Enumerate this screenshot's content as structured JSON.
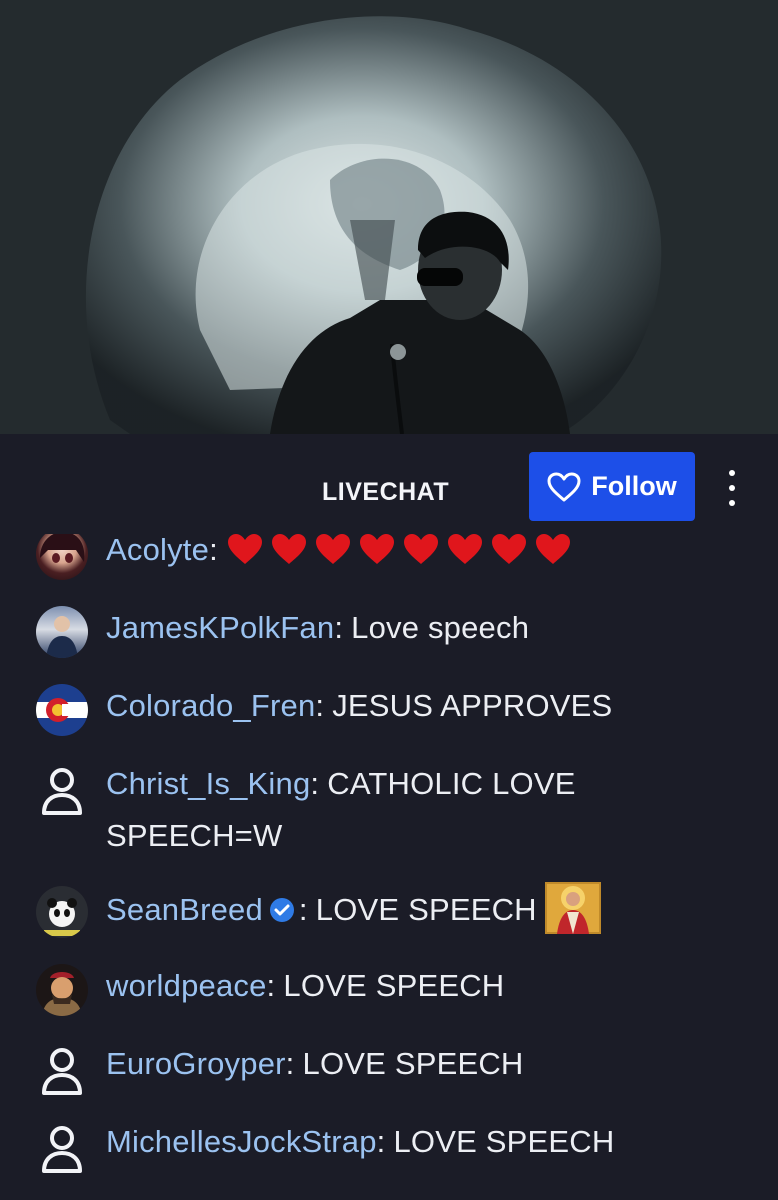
{
  "chat": {
    "title": "LIVECHAT",
    "follow_label": "Follow",
    "messages": [
      {
        "user": "Acolyte",
        "text": "",
        "emote": "red-hearts",
        "avatar": "anime-avatar"
      },
      {
        "user": "JamesKPolkFan",
        "text": "Love speech",
        "avatar": "photo-avatar"
      },
      {
        "user": "Colorado_Fren",
        "text": "JESUS APPROVES",
        "avatar": "colorado-flag-avatar"
      },
      {
        "user": "Christ_Is_King",
        "text": "CATHOLIC LOVE SPEECH=W",
        "avatar": "default-user-icon"
      },
      {
        "user": "SeanBreed",
        "text": "LOVE SPEECH",
        "verified": true,
        "emote": "christ-icon-emote",
        "avatar": "panda-avatar"
      },
      {
        "user": "worldpeace",
        "text": "LOVE SPEECH",
        "avatar": "cartoon-avatar"
      },
      {
        "user": "EuroGroyper",
        "text": "LOVE SPEECH",
        "avatar": "default-user-icon"
      },
      {
        "user": "MichellesJockStrap",
        "text": "LOVE SPEECH",
        "avatar": "default-user-icon"
      }
    ]
  },
  "colors": {
    "background": "#1b1c27",
    "username": "#9bc2f0",
    "follow_button": "#1d4fe8",
    "heart": "#e0161c"
  },
  "icons": [
    "heart-outline-icon",
    "kebab-menu-icon",
    "verified-icon",
    "user-icon"
  ]
}
